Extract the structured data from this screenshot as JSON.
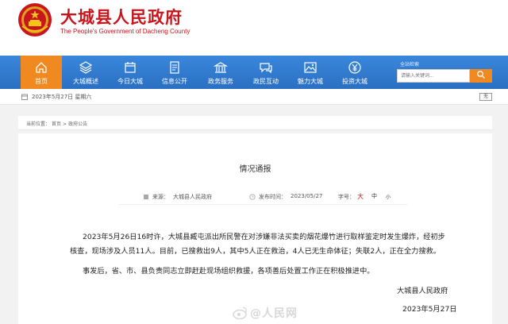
{
  "header": {
    "title": "大城县人民政府",
    "subtitle": "The People's Government of Dacheng County"
  },
  "nav": {
    "items": [
      {
        "label": "首页",
        "icon": "home-icon",
        "active": true
      },
      {
        "label": "大城概述",
        "icon": "layers-icon",
        "active": false
      },
      {
        "label": "今日大城",
        "icon": "calendar-icon",
        "active": false
      },
      {
        "label": "信息公开",
        "icon": "document-icon",
        "active": false
      },
      {
        "label": "政务服务",
        "icon": "building-icon",
        "active": false
      },
      {
        "label": "政民互动",
        "icon": "chat-icon",
        "active": false
      },
      {
        "label": "魅力大城",
        "icon": "picture-icon",
        "active": false
      },
      {
        "label": "投资大城",
        "icon": "yuan-icon",
        "active": false
      }
    ],
    "search_label": "全站检索",
    "search_placeholder": "请输入关键词..."
  },
  "datebar": {
    "date": "2023年5月27日 星期六",
    "right_label": "无"
  },
  "breadcrumb": {
    "label": "当前位置：",
    "items": [
      "首页",
      "政府公告"
    ],
    "sep": ">"
  },
  "article": {
    "title": "情况通报",
    "source_label": "来源：",
    "source": "大城县人民政府",
    "date_label": "发布时间：",
    "date": "2023/05/27",
    "font_label": "字号：",
    "font_large": "大",
    "font_medium": "中",
    "font_small": "小",
    "p1_line1": "2023年5月26日16时许，大城县臧屯派出所民警在对涉嫌非法买卖的烟花爆竹进行取样鉴定时发生爆炸，经初步",
    "p1_line2": "核查，现场涉及人员11人。目前，已搜救出9人，其中5人正在救治，4人已无生命体征；失联2人，正在全力搜救。",
    "p2": "事发后，省、市、县负责同志立即赶赴现场组织救援，各项善后处置工作正在积极推进中。",
    "signature": "大城县人民政府",
    "sign_date": "2023年5月27日"
  },
  "watermark": "@人民网",
  "colors": {
    "brand_red": "#c8161d",
    "nav_blue": "#2f7bd3",
    "accent_orange": "#f0891f"
  }
}
